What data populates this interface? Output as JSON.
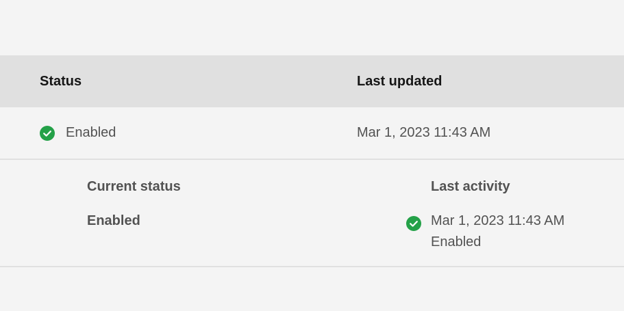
{
  "table": {
    "headers": {
      "status": "Status",
      "last_updated": "Last updated"
    },
    "rows": [
      {
        "status_icon": "checkmark-filled-icon",
        "status": "Enabled",
        "last_updated": "Mar 1, 2023 11:43 AM"
      }
    ]
  },
  "details": {
    "current_status_label": "Current status",
    "current_status_value": "Enabled",
    "last_activity_label": "Last activity",
    "last_activity_icon": "checkmark-filled-icon",
    "last_activity_time": "Mar 1, 2023 11:43 AM",
    "last_activity_status": "Enabled"
  },
  "colors": {
    "success": "#24a148",
    "header_bg": "#e0e0e0",
    "page_bg": "#f4f4f4"
  }
}
